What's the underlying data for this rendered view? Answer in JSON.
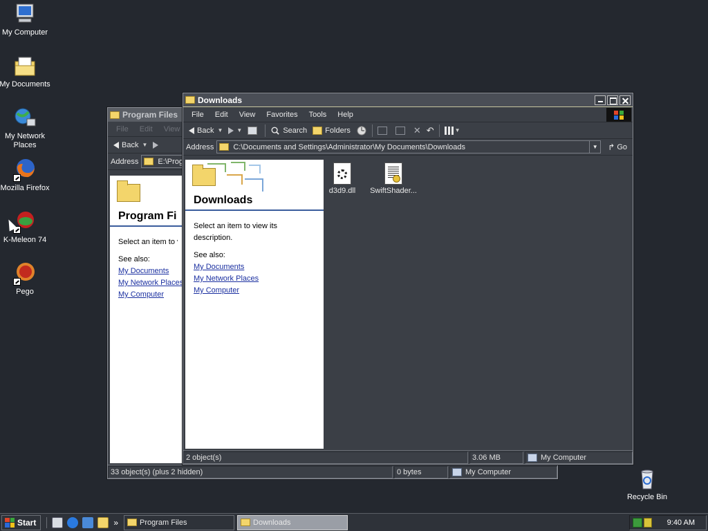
{
  "desktop": {
    "icons": [
      {
        "label": "My Computer",
        "icon": "my-computer-icon"
      },
      {
        "label": "My Documents",
        "icon": "my-documents-icon"
      },
      {
        "label": "My Network Places",
        "icon": "network-places-icon"
      },
      {
        "label": "Mozilla Firefox",
        "icon": "firefox-icon"
      },
      {
        "label": "K-Meleon 74",
        "icon": "k-meleon-icon"
      },
      {
        "label": "Pego",
        "icon": "pego-icon"
      },
      {
        "label": "Recycle Bin",
        "icon": "recycle-bin-icon"
      }
    ]
  },
  "window_program_files": {
    "title": "Program Files",
    "menu": [
      "File",
      "Edit",
      "View"
    ],
    "toolbar": {
      "back": "Back"
    },
    "address": {
      "label": "Address",
      "value": "E:\\Prog"
    },
    "taskpane": {
      "title": "Program Fi",
      "description": "Select an item to vi",
      "see_also": "See also:",
      "links": [
        "My Documents",
        "My Network Places",
        "My Computer"
      ]
    },
    "status": {
      "objects": "33 object(s) (plus 2 hidden)",
      "size": "0 bytes",
      "zone": "My Computer"
    }
  },
  "window_downloads": {
    "title": "Downloads",
    "menu": [
      "File",
      "Edit",
      "View",
      "Favorites",
      "Tools",
      "Help"
    ],
    "toolbar": {
      "back": "Back",
      "search": "Search",
      "folders": "Folders"
    },
    "address": {
      "label": "Address",
      "value": "C:\\Documents and Settings\\Administrator\\My Documents\\Downloads",
      "go": "Go"
    },
    "taskpane": {
      "title": "Downloads",
      "description": "Select an item to view its description.",
      "see_also": "See also:",
      "links": [
        "My Documents",
        "My Network Places",
        "My Computer"
      ]
    },
    "files": [
      {
        "name": "d3d9.dll",
        "icon": "dll-file-icon"
      },
      {
        "name": "SwiftShader...",
        "icon": "setup-file-icon"
      }
    ],
    "status": {
      "objects": "2 object(s)",
      "size": "3.06 MB",
      "zone": "My Computer"
    }
  },
  "taskbar": {
    "start": "Start",
    "buttons": [
      "Program Files",
      "Downloads"
    ],
    "quicklaunch_more": "»",
    "clock": "9:40 AM"
  }
}
